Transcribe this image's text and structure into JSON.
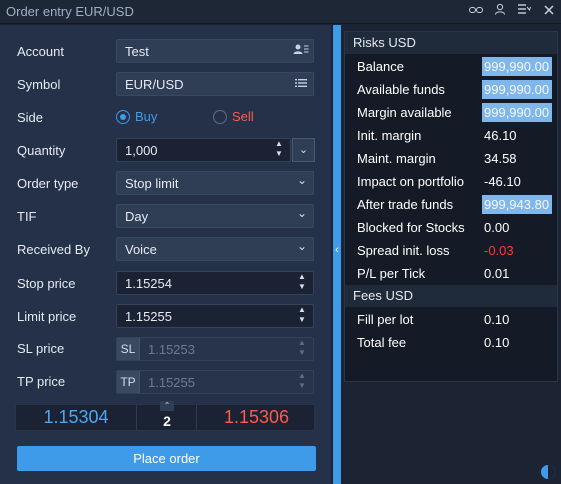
{
  "window": {
    "title": "Order entry  EUR/USD"
  },
  "colors": {
    "accent": "#3d9be9",
    "bid": "#4aa8f0",
    "ask": "#ff5a4e",
    "sell": "#ff5a4e",
    "negative": "#ff3b30"
  },
  "form": {
    "account_label": "Account",
    "account_value": "Test",
    "symbol_label": "Symbol",
    "symbol_value": "EUR/USD",
    "side_label": "Side",
    "side_buy": "Buy",
    "side_sell": "Sell",
    "side_selected": "Buy",
    "quantity_label": "Quantity",
    "quantity_value": "1,000",
    "order_type_label": "Order type",
    "order_type_value": "Stop limit",
    "tif_label": "TIF",
    "tif_value": "Day",
    "received_by_label": "Received By",
    "received_by_value": "Voice",
    "stop_price_label": "Stop price",
    "stop_price_value": "1.15254",
    "limit_price_label": "Limit price",
    "limit_price_value": "1.15255",
    "sl_price_label": "SL price",
    "sl_prefix": "SL",
    "sl_value": "1.15253",
    "tp_price_label": "TP price",
    "tp_prefix": "TP",
    "tp_value": "1.15255"
  },
  "quotes": {
    "bid": "1.15304",
    "spread": "2",
    "ask": "1.15306"
  },
  "place_order_label": "Place order",
  "risks": {
    "title": "Risks USD",
    "rows": [
      {
        "label": "Balance",
        "value": "999,990.00"
      },
      {
        "label": "Available  funds",
        "value": "999,990.00"
      },
      {
        "label": "Margin available",
        "value": "999,990.00"
      },
      {
        "label": "Init. margin",
        "value": "46.10"
      },
      {
        "label": "Maint. margin",
        "value": "34.58"
      },
      {
        "label": "Impact on portfolio",
        "value": "-46.10"
      },
      {
        "label": "After trade funds",
        "value": "999,943.80"
      },
      {
        "label": "Blocked for Stocks",
        "value": "0.00"
      },
      {
        "label": "Spread init. loss",
        "value": "-0.03"
      },
      {
        "label": "P/L per Tick",
        "value": "0.01"
      }
    ]
  },
  "fees": {
    "title": "Fees USD",
    "rows": [
      {
        "label": "Fill per lot",
        "value": "0.10"
      },
      {
        "label": "Total fee",
        "value": "0.10"
      }
    ]
  }
}
